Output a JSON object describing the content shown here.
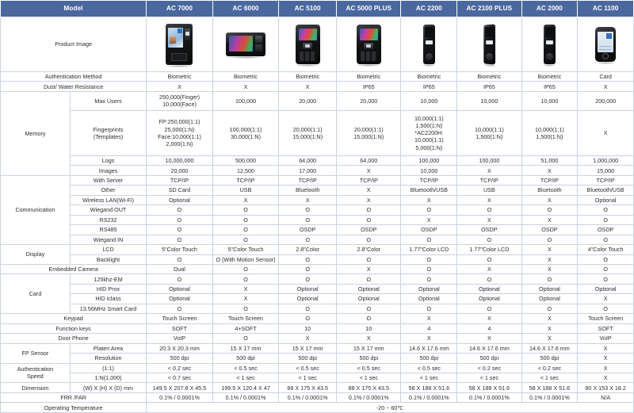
{
  "header": {
    "model_label": "Model",
    "models": [
      "AC 7000",
      "AC 6000",
      "AC 5100",
      "AC 5000 PLUS",
      "AC 2200",
      "AC 2100 PLUS",
      "AC 2000",
      "AC 1100"
    ]
  },
  "colors": {
    "header_bg": "#4a679e",
    "header_text": "#ffffff",
    "label_text": "#2b4f8e",
    "value_text": "#2d2d2d",
    "border": "#c9d3e0"
  },
  "rows": {
    "product_image": {
      "label": "Product Image"
    },
    "auth_method": {
      "label": "Authentication Method",
      "values": [
        "Biometric",
        "Biometric",
        "Biometric",
        "Biometric",
        "Biometric",
        "Biometric",
        "Biometric",
        "Card"
      ]
    },
    "dust_water": {
      "label": "Dust/ Water Resistance",
      "values": [
        "X",
        "X",
        "X",
        "IP65",
        "IP65",
        "IP65",
        "IP65",
        "X"
      ]
    },
    "memory": {
      "group_label": "Memory",
      "max_users": {
        "label": "Max Users",
        "values": [
          "250,000(Finger)\n10,000(Face)",
          "100,000",
          "20,000",
          "20,000",
          "10,000",
          "10,000",
          "10,000",
          "200,000"
        ]
      },
      "fingerprints": {
        "label": "Fingerprints\n(Templates)",
        "values": [
          "FP:250,000(1:1)\n25,000(1:N)\nFace:10,000(1:1)\n2,000(1:N)",
          "100,000(1:1)\n30,000(1:N)",
          "20,000(1:1)\n15,000(1:N)",
          "20,000(1:1)\n15,000(1:N)",
          "10,000(1:1)\n1,500(1:N)\n*AC2200H: 10,000(1:1)\n5,000(1:N)",
          "10,000(1:1)\n1,500(1:N)",
          "10,000(1:1)\n1,500(1:N)",
          "X"
        ]
      },
      "logs": {
        "label": "Logs",
        "values": [
          "10,000,000",
          "500,000",
          "64,000",
          "64,000",
          "100,000",
          "100,000",
          "51,000",
          "1,000,000"
        ]
      },
      "images": {
        "label": "Images",
        "values": [
          "20,000",
          "12,500",
          "17,000",
          "X",
          "10,000",
          "X",
          "X",
          "15,000"
        ]
      }
    },
    "communication": {
      "group_label": "Communication",
      "with_server": {
        "label": "With Server",
        "values": [
          "TCP/IP",
          "TCP/IP",
          "TCP/IP",
          "TCP/IP",
          "TCP/IP",
          "TCP/IP",
          "TCP/IP",
          "TCP/IP"
        ]
      },
      "other": {
        "label": "Other",
        "values": [
          "SD Card",
          "USB",
          "Bluetooth",
          "X",
          "Bluetooth/USB",
          "USB",
          "Bluetooth",
          "Bluetooth/USB"
        ]
      },
      "wireless_lan": {
        "label": "Wireless LAN(Wi-Fi)",
        "values": [
          "Optional",
          "X",
          "X",
          "X",
          "X",
          "X",
          "X",
          "Optional"
        ]
      },
      "wiegand_out": {
        "label": "Wiegand OUT",
        "values": [
          "O",
          "O",
          "O",
          "O",
          "O",
          "O",
          "O",
          "O"
        ]
      },
      "rs232": {
        "label": "RS232",
        "values": [
          "O",
          "O",
          "O",
          "O",
          "X",
          "X",
          "X",
          "O"
        ]
      },
      "rs485": {
        "label": "RS485",
        "values": [
          "O",
          "O",
          "OSDP",
          "OSDP",
          "OSDP",
          "OSDP",
          "OSDP",
          "OSDP"
        ]
      },
      "wiegand_in": {
        "label": "Wiegand IN",
        "values": [
          "O",
          "O",
          "O",
          "O",
          "O",
          "O",
          "O",
          "O"
        ]
      }
    },
    "display": {
      "group_label": "Display",
      "lcd": {
        "label": "LCD",
        "values": [
          "5\"Color Touch",
          "5\"Color Touch",
          "2.8\"Color",
          "2.8\"Color",
          "1.77\"Color LCD",
          "1.77\"Color LCD",
          "X",
          "4\"Color Touch"
        ]
      },
      "backlight": {
        "label": "Backlight",
        "values": [
          "O",
          "O (With Motion Sensor)",
          "O",
          "O",
          "O",
          "O",
          "X",
          "O"
        ]
      }
    },
    "embedded_camera": {
      "label": "Embedded Camera",
      "values": [
        "Dual",
        "O",
        "O",
        "X",
        "O",
        "X",
        "X",
        "O"
      ]
    },
    "card": {
      "group_label": "Card",
      "em125": {
        "label": "125khz-EM",
        "values": [
          "O",
          "O",
          "O",
          "O",
          "O",
          "O",
          "O",
          "O"
        ]
      },
      "hid_prox": {
        "label": "HID Prox",
        "values": [
          "Optional",
          "X",
          "Optional",
          "Optional",
          "Optional",
          "Optional",
          "Optional",
          "Optional"
        ]
      },
      "hid_iclass": {
        "label": "HID iclass",
        "values": [
          "Optional",
          "X",
          "Optional",
          "Optional",
          "Optional",
          "Optional",
          "Optional",
          "X"
        ]
      },
      "smart_card": {
        "label": "13.56MHz Smart Card",
        "values": [
          "O",
          "O",
          "O",
          "O",
          "O",
          "O",
          "O",
          "O"
        ]
      }
    },
    "keypad": {
      "label": "Keypad",
      "values": [
        "Touch Screen",
        "Touch Screen",
        "O",
        "O",
        "X",
        "X",
        "X",
        "Touch Screen"
      ]
    },
    "function_keys": {
      "label": "Function keys",
      "values": [
        "SOFT",
        "4+SOFT",
        "10",
        "10",
        "4",
        "4",
        "X",
        "SOFT"
      ]
    },
    "door_phone": {
      "label": "Door Phone",
      "values": [
        "VoIP",
        "O",
        "X",
        "X",
        "X",
        "X",
        "X",
        "VoIP"
      ]
    },
    "fp_sensor": {
      "group_label": "FP Sensor",
      "platen_area": {
        "label": "Platen Area",
        "values": [
          "20.3 X 20.3 mm",
          "15 X 17 mm",
          "15 X 17 mm",
          "15 X 17 mm",
          "14.6 X 17.6 mm",
          "14.6 X 17.6 mm",
          "14.6 X 17.6 mm",
          "X"
        ]
      },
      "resolution": {
        "label": "Resolution",
        "values": [
          "500 dpi",
          "500 dpi",
          "500 dpi",
          "500 dpi",
          "500 dpi",
          "500 dpi",
          "500 dpi",
          "X"
        ]
      }
    },
    "auth_speed": {
      "group_label": "Authentication\nSpeed",
      "one_to_one": {
        "label": "(1:1)",
        "values": [
          "< 0.2 sec",
          "< 0.5 sec",
          "< 0.5 sec",
          "< 0.5 sec",
          "< 0.5 sec",
          "< 0.2 sec",
          "< 0.2 sec",
          "X"
        ]
      },
      "one_to_n": {
        "label": "1:N(1,000)",
        "values": [
          "< 0.7 sec",
          "< 1 sec",
          "< 1 sec",
          "< 1 sec",
          "< 1 sec",
          "< 1 sec",
          "< 1 sec",
          "X"
        ]
      }
    },
    "dimension": {
      "group_label": "Dimension",
      "sub_label": "(W) X (H) X (D) mm",
      "values": [
        "149.5 X 207.8 X 45.5",
        "199.5 X 120.4 X 47",
        "88 X 175 X 43.5",
        "88 X 175 X 43.5",
        "58 X 188 X 51.6",
        "58 X 188 X 51.6",
        "58 X 188 X 51.6",
        "80 X 153 X 18.2"
      ]
    },
    "frr_far": {
      "label": "FRR /FAR",
      "values": [
        "0.1% / 0.0001%",
        "0.1% / 0.0001%",
        "0.1% / 0.0001%",
        "0.1% / 0.0001%",
        "0.1% / 0.0001%",
        "0.1% / 0.0001%",
        "0.1% / 0.0001%",
        "N/A"
      ]
    },
    "operating_temperature": {
      "label": "Operating Temperature",
      "value": "-20 ~ 60℃"
    }
  }
}
